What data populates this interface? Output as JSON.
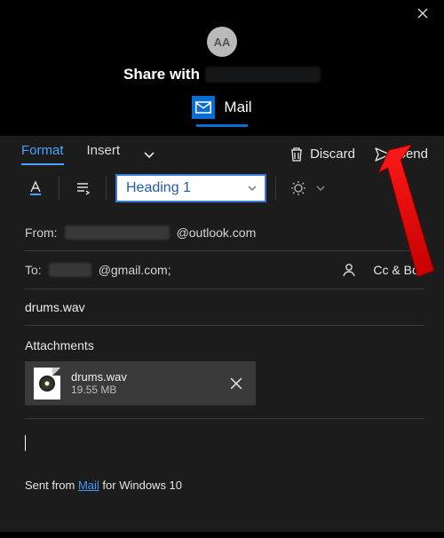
{
  "titlebar": {
    "avatar_initials": "AA",
    "share_label": "Share with",
    "app_name": "Mail"
  },
  "ribbon": {
    "tabs": {
      "format": "Format",
      "insert": "Insert"
    },
    "actions": {
      "discard": "Discard",
      "send": "Send"
    },
    "style_select": "Heading 1"
  },
  "fields": {
    "from_label": "From:",
    "from_domain": "@outlook.com",
    "to_label": "To:",
    "to_domain": "@gmail.com;",
    "cc_bcc": "Cc & Bcc"
  },
  "subject": "drums.wav",
  "attachments": {
    "label": "Attachments",
    "items": [
      {
        "name": "drums.wav",
        "size": "19.55 MB"
      }
    ]
  },
  "signature": {
    "prefix": "Sent from ",
    "link": "Mail",
    "suffix": " for Windows 10"
  },
  "icons": {
    "close": "close-icon",
    "chevron": "chevron-down-icon",
    "trash": "trash-icon",
    "send": "send-icon",
    "font_color": "font-color-icon",
    "paragraph": "paragraph-icon",
    "brightness": "brightness-icon",
    "person": "person-icon"
  }
}
